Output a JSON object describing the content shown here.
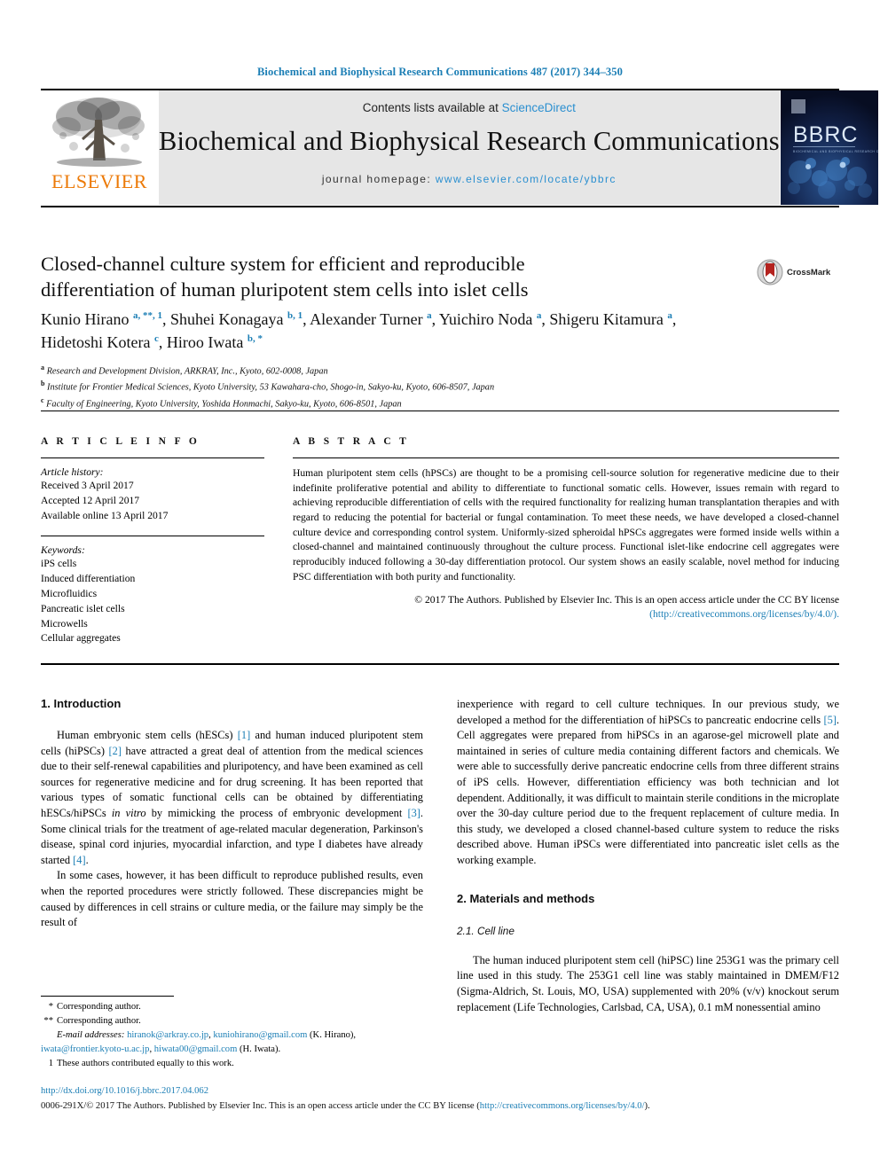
{
  "running_head": "Biochemical and Biophysical Research Communications 487 (2017) 344–350",
  "masthead": {
    "contents_prefix": "Contents lists available at ",
    "sciencedirect": "ScienceDirect",
    "journal_title": "Biochemical and Biophysical Research Communications",
    "homepage_label": "journal homepage: ",
    "homepage_url": "www.elsevier.com/locate/ybbrc",
    "publisher_logo_text": "ELSEVIER",
    "cover_title": "BBRC",
    "cover_subtitle": "BIOCHEMICAL AND BIOPHYSICAL RESEARCH COMMUNICATIONS"
  },
  "colors": {
    "link_blue": "#1b7eb5",
    "sciencedirect_blue": "#2a8fd0",
    "elsevier_orange": "#ec7a08",
    "band_gray": "#e6e6e6",
    "cover_navy": "#0b1430"
  },
  "article": {
    "title_line1": "Closed-channel culture system for efficient and reproducible",
    "title_line2": "differentiation of human pluripotent stem cells into islet cells",
    "authors_html": "Kunio Hirano <sup>a, **, 1</sup>, Shuhei Konagaya <sup>b, 1</sup>, Alexander Turner <sup>a</sup>, Yuichiro Noda <sup>a</sup>, Shigeru Kitamura <sup>a</sup>, Hidetoshi Kotera <sup>c</sup>, Hiroo Iwata <sup>b, *</sup>",
    "affiliations": [
      {
        "mark": "a",
        "text": "Research and Development Division, ARKRAY, Inc., Kyoto, 602-0008, Japan"
      },
      {
        "mark": "b",
        "text": "Institute for Frontier Medical Sciences, Kyoto University, 53 Kawahara-cho, Shogo-in, Sakyo-ku, Kyoto, 606-8507, Japan"
      },
      {
        "mark": "c",
        "text": "Faculty of Engineering, Kyoto University, Yoshida Honmachi, Sakyo-ku, Kyoto, 606-8501, Japan"
      }
    ],
    "crossmark_label": "CrossMark"
  },
  "article_info": {
    "heading": "A R T I C L E  I N F O",
    "history_label": "Article history:",
    "history": [
      "Received 3 April 2017",
      "Accepted 12 April 2017",
      "Available online 13 April 2017"
    ],
    "keywords_label": "Keywords:",
    "keywords": [
      "iPS cells",
      "Induced differentiation",
      "Microfluidics",
      "Pancreatic islet cells",
      "Microwells",
      "Cellular aggregates"
    ]
  },
  "abstract": {
    "heading": "A B S T R A C T",
    "body": "Human pluripotent stem cells (hPSCs) are thought to be a promising cell-source solution for regenerative medicine due to their indefinite proliferative potential and ability to differentiate to functional somatic cells. However, issues remain with regard to achieving reproducible differentiation of cells with the required functionality for realizing human transplantation therapies and with regard to reducing the potential for bacterial or fungal contamination. To meet these needs, we have developed a closed-channel culture device and corresponding control system. Uniformly-sized spheroidal hPSCs aggregates were formed inside wells within a closed-channel and maintained continuously throughout the culture process. Functional islet-like endocrine cell aggregates were reproducibly induced following a 30-day differentiation protocol. Our system shows an easily scalable, novel method for inducing PSC differentiation with both purity and functionality.",
    "copyright_text": "© 2017 The Authors. Published by Elsevier Inc. This is an open access article under the CC BY license",
    "license_url": "(http://creativecommons.org/licenses/by/4.0/)."
  },
  "body": {
    "section1_title": "1. Introduction",
    "section2_title": "2. Materials and methods",
    "subsection21_title": "2.1. Cell line",
    "left_paragraphs": [
      {
        "segments": [
          {
            "t": "Human embryonic stem cells (hESCs) "
          },
          {
            "t": "[1]",
            "ref": true
          },
          {
            "t": " and human induced pluripotent stem cells (hiPSCs) "
          },
          {
            "t": "[2]",
            "ref": true
          },
          {
            "t": " have attracted a great deal of attention from the medical sciences due to their self-renewal capabilities and pluripotency, and have been examined as cell sources for regenerative medicine and for drug screening. It has been reported that various types of somatic functional cells can be obtained by differentiating hESCs/hiPSCs "
          },
          {
            "t": "in vitro",
            "italic": true
          },
          {
            "t": " by mimicking the process of embryonic development "
          },
          {
            "t": "[3]",
            "ref": true
          },
          {
            "t": ". Some clinical trials for the treatment of age-related macular degeneration, Parkinson's disease, spinal cord injuries, myocardial infarction, and type I diabetes have already started "
          },
          {
            "t": "[4]",
            "ref": true
          },
          {
            "t": "."
          }
        ]
      },
      {
        "segments": [
          {
            "t": "In some cases, however, it has been difficult to reproduce published results, even when the reported procedures were strictly followed. These discrepancies might be caused by differences in cell strains or culture media, or the failure may simply be the result of"
          }
        ]
      }
    ],
    "right_paragraphs": [
      {
        "segments": [
          {
            "t": "inexperience with regard to cell culture techniques. In our previous study, we developed a method for the differentiation of hiPSCs to pancreatic endocrine cells "
          },
          {
            "t": "[5]",
            "ref": true
          },
          {
            "t": ". Cell aggregates were prepared from hiPSCs in an agarose-gel microwell plate and maintained in series of culture media containing different factors and chemicals. We were able to successfully derive pancreatic endocrine cells from three different strains of iPS cells. However, differentiation efficiency was both technician and lot dependent. Additionally, it was difficult to maintain sterile conditions in the microplate over the 30-day culture period due to the frequent replacement of culture media. In this study, we developed a closed channel-based culture system to reduce the risks described above. Human iPSCs were differentiated into pancreatic islet cells as the working example."
          }
        ]
      }
    ],
    "cellline_paragraph": {
      "segments": [
        {
          "t": "The human induced pluripotent stem cell (hiPSC) line 253G1 was the primary cell line used in this study. The 253G1 cell line was stably maintained in DMEM/F12 (Sigma-Aldrich, St. Louis, MO, USA) supplemented with 20% (v/v) knockout serum replacement (Life Technologies, Carlsbad, CA, USA), 0.1 mM nonessential amino"
        }
      ]
    }
  },
  "footnotes": {
    "corresponding1_mark": "*",
    "corresponding1_text": "Corresponding author.",
    "corresponding2_mark": "**",
    "corresponding2_text": "Corresponding author.",
    "email_label": "E-mail addresses:",
    "emails": [
      {
        "addr": "hiranok@arkray.co.jp",
        "sep": ", "
      },
      {
        "addr": "kuniohirano@gmail.com",
        "sep": " "
      }
    ],
    "email_attrib1": "(K. Hirano),",
    "emails2": [
      {
        "addr": "iwata@frontier.kyoto-u.ac.jp",
        "sep": ", "
      },
      {
        "addr": "hiwata00@gmail.com",
        "sep": " "
      }
    ],
    "email_attrib2": "(H. Iwata).",
    "equal_mark": "1",
    "equal_text": "These authors contributed equally to this work."
  },
  "footer": {
    "doi": "http://dx.doi.org/10.1016/j.bbrc.2017.04.062",
    "issn_copyright": "0006-291X/© 2017 The Authors. Published by Elsevier Inc. This is an open access article under the CC BY license (",
    "license_url": "http://creativecommons.org/licenses/by/4.0/",
    "issn_copyright_tail": ")."
  }
}
